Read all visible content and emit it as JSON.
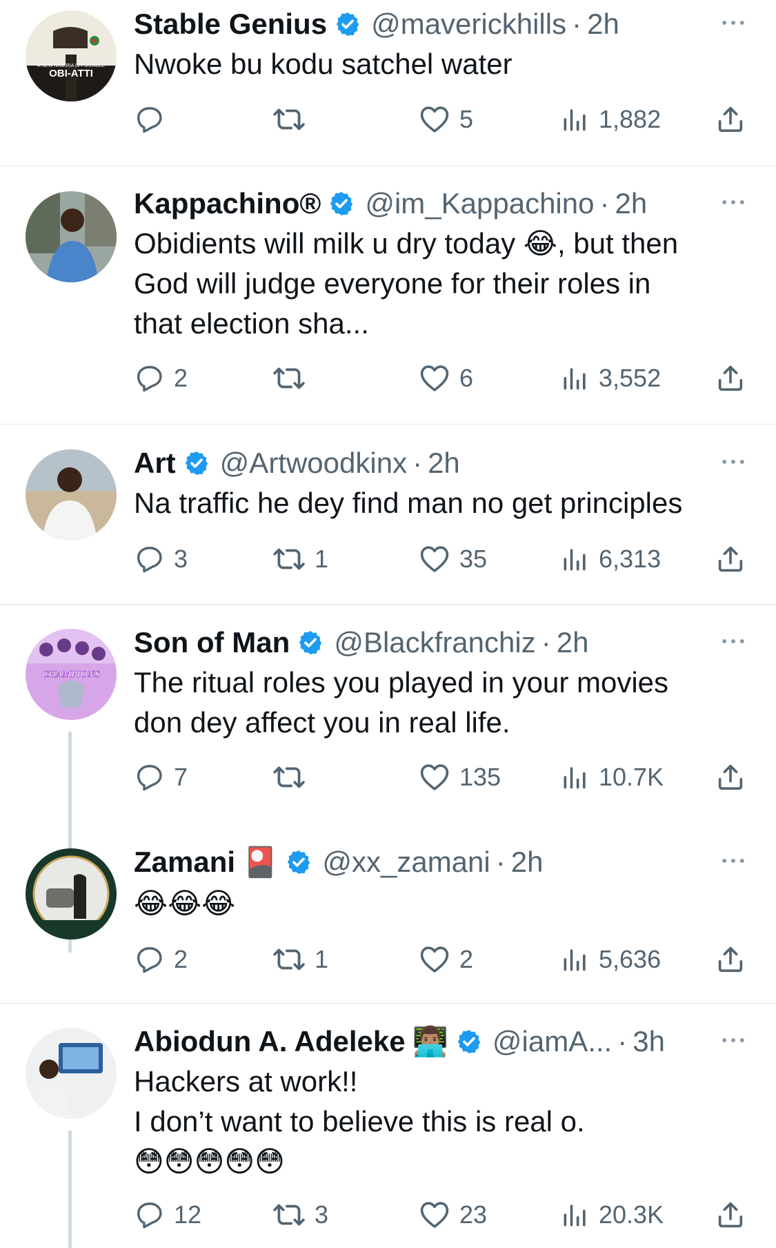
{
  "tweets": [
    {
      "name": "Stable Genius",
      "name_emoji": "",
      "handle": "@maverickhills",
      "time": "2h",
      "body": [
        "Nwoke bu kodu satchel water"
      ],
      "replies": "",
      "retweets": "",
      "likes": "5",
      "views": "1,882",
      "avatar_text": [
        "A NEW NIGERIA IS POSSIBLE",
        "OBI-ATTI"
      ]
    },
    {
      "name": "Kappachino®",
      "name_emoji": "",
      "handle": "@im_Kappachino",
      "time": "2h",
      "body": [
        "Obidients will milk u dry today 😂, but then",
        "God will judge everyone for their roles in",
        "that election sha..."
      ],
      "replies": "2",
      "retweets": "",
      "likes": "6",
      "views": "3,552"
    },
    {
      "name": "Art",
      "name_emoji": "",
      "handle": "@Artwoodkinx",
      "time": "2h",
      "body": [
        "Na traffic he dey find man no get principles"
      ],
      "replies": "3",
      "retweets": "1",
      "likes": "35",
      "views": "6,313"
    },
    {
      "name": "Son of Man",
      "name_emoji": "",
      "handle": "@Blackfranchiz",
      "time": "2h",
      "body": [
        "The ritual roles you played in your movies",
        "don dey affect you in real life."
      ],
      "replies": "7",
      "retweets": "",
      "likes": "135",
      "views": "10.7K",
      "avatar_text": [
        "CHAMPIONS"
      ]
    },
    {
      "name": "Zamani",
      "name_emoji": "🎴",
      "handle": "@xx_zamani",
      "time": "2h",
      "body": [
        "😂😂😂"
      ],
      "replies": "2",
      "retweets": "1",
      "likes": "2",
      "views": "5,636"
    },
    {
      "name": "Abiodun A. Adeleke",
      "name_emoji": "👨🏽‍💻",
      "handle": "@iamA...",
      "time": "3h",
      "body": [
        "Hackers at work!!",
        "I don’t want to believe this is real o.",
        "😳😳😳😳😳"
      ],
      "replies": "12",
      "retweets": "3",
      "likes": "23",
      "views": "20.3K"
    }
  ],
  "colors": {
    "verified": "#1d9bf0",
    "text": "#0f1419",
    "secondary": "#536471",
    "divider": "#e1e5e8",
    "thread_line": "#cfd9de"
  },
  "icons": {
    "reply": "reply-icon",
    "retweet": "retweet-icon",
    "like": "heart-icon",
    "views": "views-icon",
    "share": "share-icon",
    "more": "more-icon",
    "verified": "verified-badge-icon"
  }
}
